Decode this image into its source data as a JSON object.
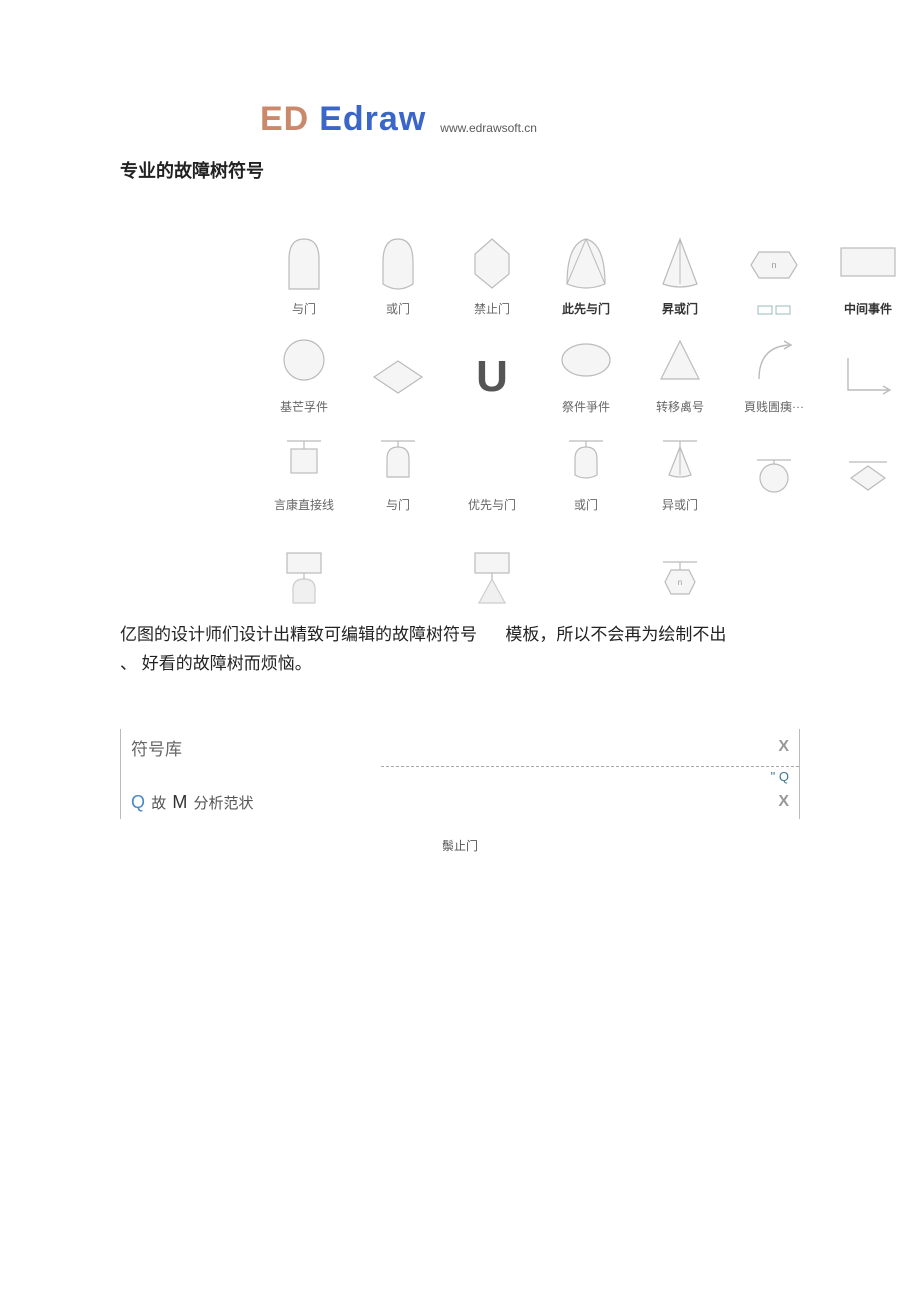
{
  "logo": {
    "prefix": "ED",
    "name": "Edraw",
    "url": "www.edrawsoft.cn"
  },
  "heading": "专业的故障树符号",
  "symbols": {
    "row1": [
      {
        "label": "与门",
        "bold": false
      },
      {
        "label": "或门",
        "bold": false
      },
      {
        "label": "禁止门",
        "bold": false
      },
      {
        "label": "此先与门",
        "bold": true
      },
      {
        "label": "昇或门",
        "bold": true
      },
      {
        "label": "",
        "bold": false
      },
      {
        "label": "中间事件",
        "bold": true
      }
    ],
    "row2": [
      {
        "label": "基芒孚件",
        "bold": false
      },
      {
        "label": "",
        "bold": false
      },
      {
        "label": "",
        "bold": false
      },
      {
        "label": "祭件爭件",
        "bold": false
      },
      {
        "label": "转移禼号",
        "bold": false
      },
      {
        "label": "頁贱圊痍···",
        "bold": false
      },
      {
        "label": "",
        "bold": false
      }
    ],
    "row3": [
      {
        "label": "言康直接线",
        "bold": false
      },
      {
        "label": "与门",
        "bold": false
      },
      {
        "label": "优先与门",
        "bold": false
      },
      {
        "label": "或门",
        "bold": false
      },
      {
        "label": "异或门",
        "bold": false
      },
      {
        "label": "",
        "bold": false
      },
      {
        "label": "",
        "bold": false
      }
    ]
  },
  "paragraph_a": "亿图的设计师们设计出精致可编辑的故障树符号",
  "paragraph_b": "模板，所以不会再为绘制不出",
  "paragraph_c": "、 好看的故障树而烦恼。",
  "panel": {
    "title": "符号库",
    "close": "X",
    "q_right": "\" Q",
    "row2_q": "Q",
    "row2_text1": "故",
    "row2_m": "M",
    "row2_text2": "分析范状",
    "row2_x": "X"
  },
  "small_label": "鬃止门"
}
